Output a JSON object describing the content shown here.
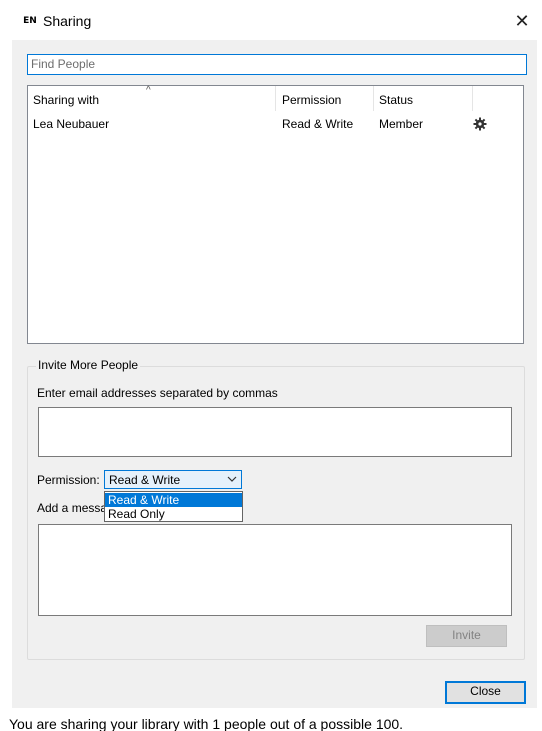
{
  "window": {
    "app_icon_text": "EN",
    "title": "Sharing",
    "close_glyph": "✕"
  },
  "find": {
    "placeholder": "Find People"
  },
  "list": {
    "columns": [
      "Sharing with",
      "Permission",
      "Status"
    ],
    "sort_indicator": "^",
    "rows": [
      {
        "name": "Lea Neubauer",
        "permission": "Read & Write",
        "status": "Member",
        "action_icon": "gear-icon"
      }
    ]
  },
  "invite": {
    "group_title": "Invite More People",
    "email_label": "Enter email addresses separated by commas",
    "email_value": "",
    "permission_label": "Permission:",
    "permission_selected": "Read & Write",
    "permission_options": [
      "Read & Write",
      "Read Only"
    ],
    "message_label": "Add a message",
    "message_value": "",
    "invite_button": "Invite"
  },
  "footer": {
    "close_button": "Close",
    "status_text": "You are sharing your library with 1 people out of a possible 100."
  },
  "colors": {
    "accent": "#0078d7",
    "panel": "#f0f0f0",
    "selection": "#0078d7"
  }
}
